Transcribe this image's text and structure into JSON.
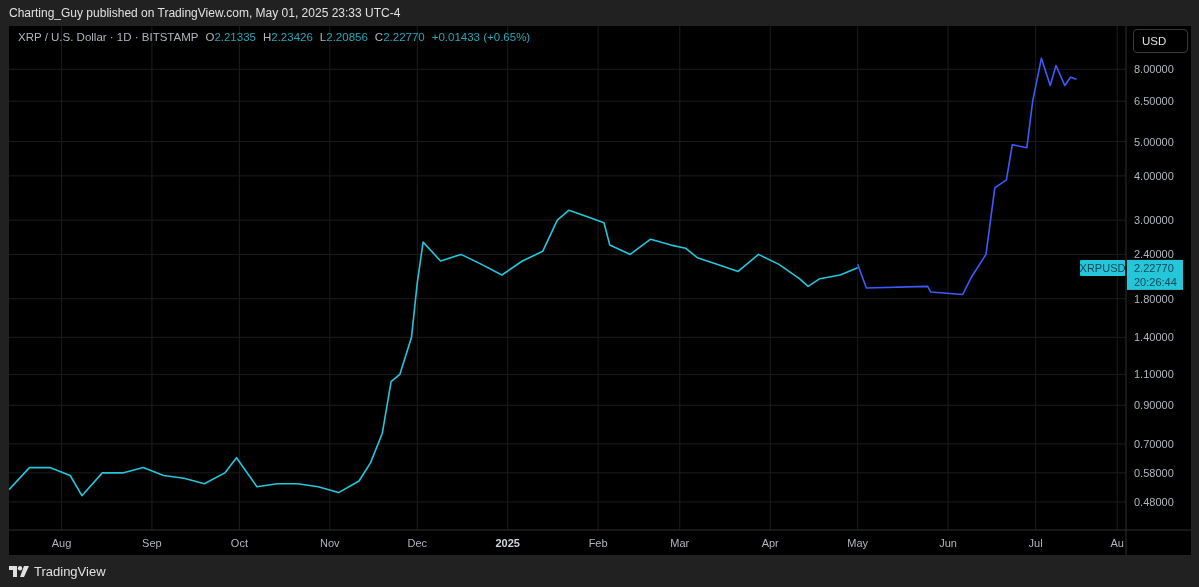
{
  "header": {
    "text": "Charting_Guy published on TradingView.com, May 01, 2025 23:33 UTC-4"
  },
  "legend": {
    "symbol": "XRP / U.S. Dollar · 1D · BITSTAMP",
    "ohlc": [
      {
        "label": "O",
        "value": "2.21335"
      },
      {
        "label": "H",
        "value": "2.23426"
      },
      {
        "label": "L",
        "value": "2.20856"
      },
      {
        "label": "C",
        "value": "2.22770"
      }
    ],
    "change": "+0.01433 (+0.65%)"
  },
  "currency_button": "USD",
  "price_tag": {
    "symbol": "XRPUSD",
    "price": "2.22770",
    "countdown": "20:26:44"
  },
  "price_axis": [
    "8.00000",
    "6.50000",
    "5.00000",
    "4.00000",
    "3.00000",
    "2.40000",
    "1.80000",
    "1.40000",
    "1.10000",
    "0.90000",
    "0.70000",
    "0.58000",
    "0.48000"
  ],
  "time_axis": [
    {
      "label": "Aug",
      "kind": "month"
    },
    {
      "label": "Sep",
      "kind": "month"
    },
    {
      "label": "Oct",
      "kind": "month"
    },
    {
      "label": "Nov",
      "kind": "month"
    },
    {
      "label": "Dec",
      "kind": "month"
    },
    {
      "label": "2025",
      "kind": "year"
    },
    {
      "label": "Feb",
      "kind": "month"
    },
    {
      "label": "Mar",
      "kind": "month"
    },
    {
      "label": "Apr",
      "kind": "month"
    },
    {
      "label": "May",
      "kind": "month"
    },
    {
      "label": "Jun",
      "kind": "month"
    },
    {
      "label": "Jul",
      "kind": "month"
    },
    {
      "label": "Au",
      "kind": "month"
    }
  ],
  "footer": {
    "brand": "TradingView"
  }
}
